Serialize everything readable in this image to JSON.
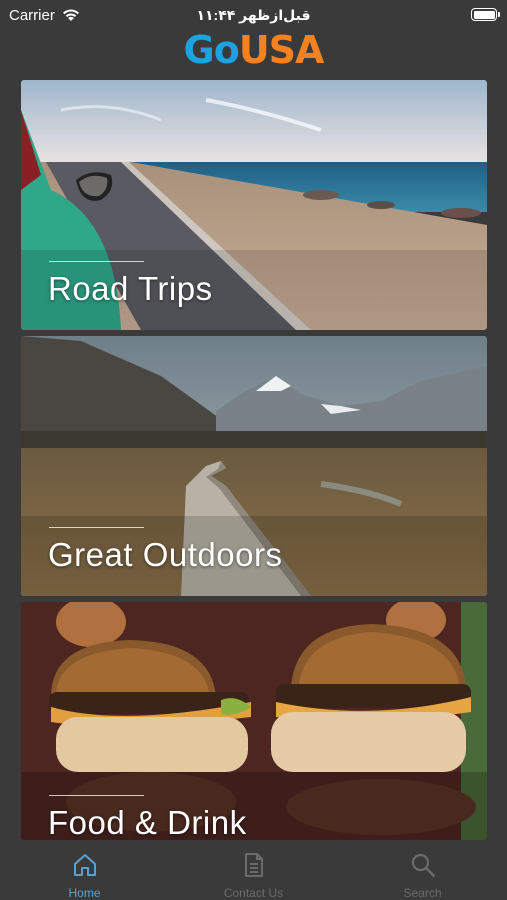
{
  "status_bar": {
    "carrier": "Carrier",
    "time": "۱۱:۴۴ قبل‌ازظهر"
  },
  "logo": {
    "go": "Go",
    "usa": "USA"
  },
  "cards": [
    {
      "title": "Road Trips"
    },
    {
      "title": "Great Outdoors"
    },
    {
      "title": "Food & Drink"
    }
  ],
  "tabbar": {
    "tabs": [
      {
        "label": "Home",
        "icon": "home-icon",
        "active": true
      },
      {
        "label": "Contact Us",
        "icon": "document-icon",
        "active": false
      },
      {
        "label": "Search",
        "icon": "search-icon",
        "active": false
      }
    ]
  },
  "colors": {
    "background": "#3a3a3a",
    "logo_go": "#1aa3e0",
    "logo_usa": "#f58220",
    "tab_active": "#5aa0d0",
    "tab_inactive": "#6b6b6b"
  }
}
